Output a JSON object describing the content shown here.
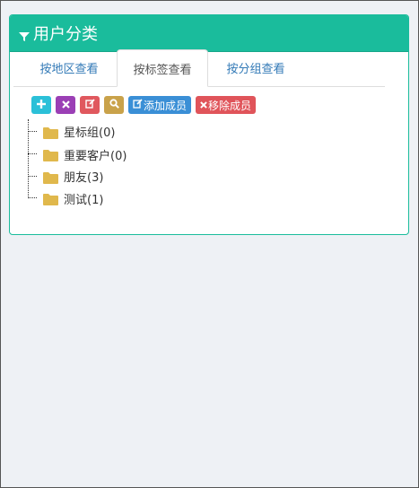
{
  "panel": {
    "title": "用户分类",
    "accent_color": "#1abc9c",
    "header_icon": "filter-icon"
  },
  "tabs": [
    {
      "label": "按地区查看",
      "active": false
    },
    {
      "label": "按标签查看",
      "active": true
    },
    {
      "label": "按分组查看",
      "active": false
    }
  ],
  "toolbar": {
    "add_icon_label": "+",
    "delete_icon_label": "✖",
    "edit_icon_label": "✎",
    "search_icon": "search-icon",
    "add_member_label": "添加成员",
    "remove_member_label": "移除成员",
    "colors": {
      "add": "#2bc0d8",
      "delete": "#9b3fb5",
      "edit": "#e0585e",
      "search": "#c9a24a",
      "add_member": "#3a8fd6",
      "remove_member": "#e0545a"
    }
  },
  "tree": {
    "items": [
      {
        "label": "星标组(0)",
        "icon": "folder-icon"
      },
      {
        "label": "重要客户(0)",
        "icon": "folder-icon"
      },
      {
        "label": "朋友(3)",
        "icon": "folder-icon"
      },
      {
        "label": "测试(1)",
        "icon": "folder-icon"
      }
    ],
    "folder_color": "#e0b84c"
  }
}
